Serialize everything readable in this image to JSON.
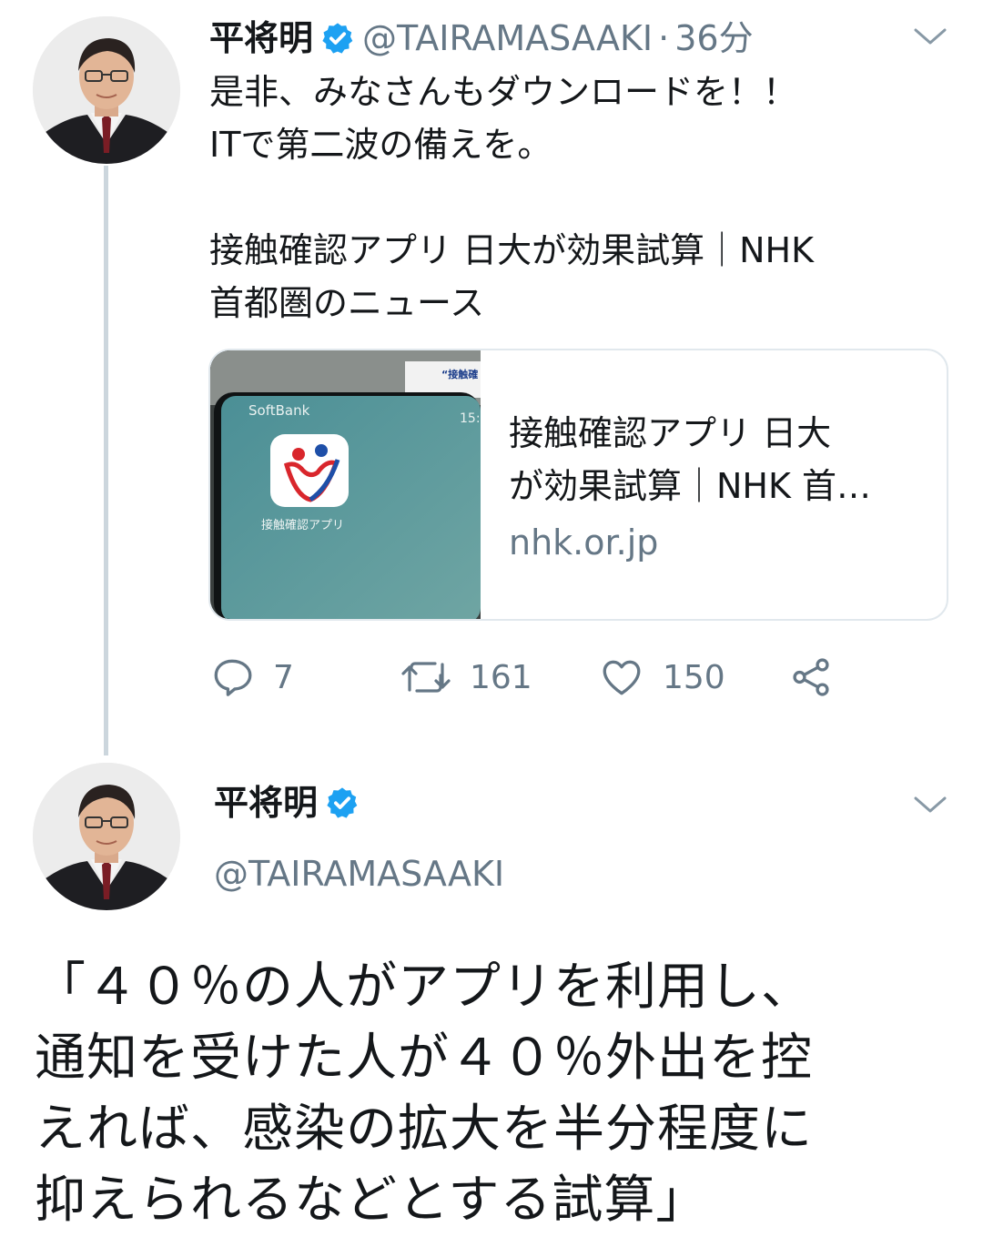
{
  "tweet1": {
    "name": "平将明",
    "verified_icon": "verified-badge-icon",
    "handle": "@TAIRAMASAAKI",
    "separator": "·",
    "time": "36分",
    "text": "是非、みなさんもダウンロードを！！\nITで第二波の備えを。\n\n接触確認アプリ 日大が効果試算｜NHK\n首都圏のニュース",
    "card": {
      "image_caption_carrier": "SoftBank",
      "image_caption_time": "15:",
      "image_app_label": "接触確認アプリ",
      "image_sign_text": "“接触確",
      "title_line1": "接触確認アプリ 日大",
      "title_line2": "が効果試算｜NHK 首…",
      "domain": "nhk.or.jp"
    },
    "actions": {
      "reply_count": "7",
      "retweet_count": "161",
      "like_count": "150"
    }
  },
  "tweet2": {
    "name": "平将明",
    "handle": "@TAIRAMASAAKI",
    "text_lines": [
      "「４０％の人がアプリを利用し、",
      "通知を受けた人が４０％外出を控",
      "えれば、感染の拡大を半分程度に",
      "抑えられるなどとする試算」"
    ]
  },
  "colors": {
    "text": "#14171a",
    "muted": "#657786",
    "verified": "#1da1f2",
    "border": "#e1e8ed",
    "thread_line": "#ccd6dd"
  }
}
